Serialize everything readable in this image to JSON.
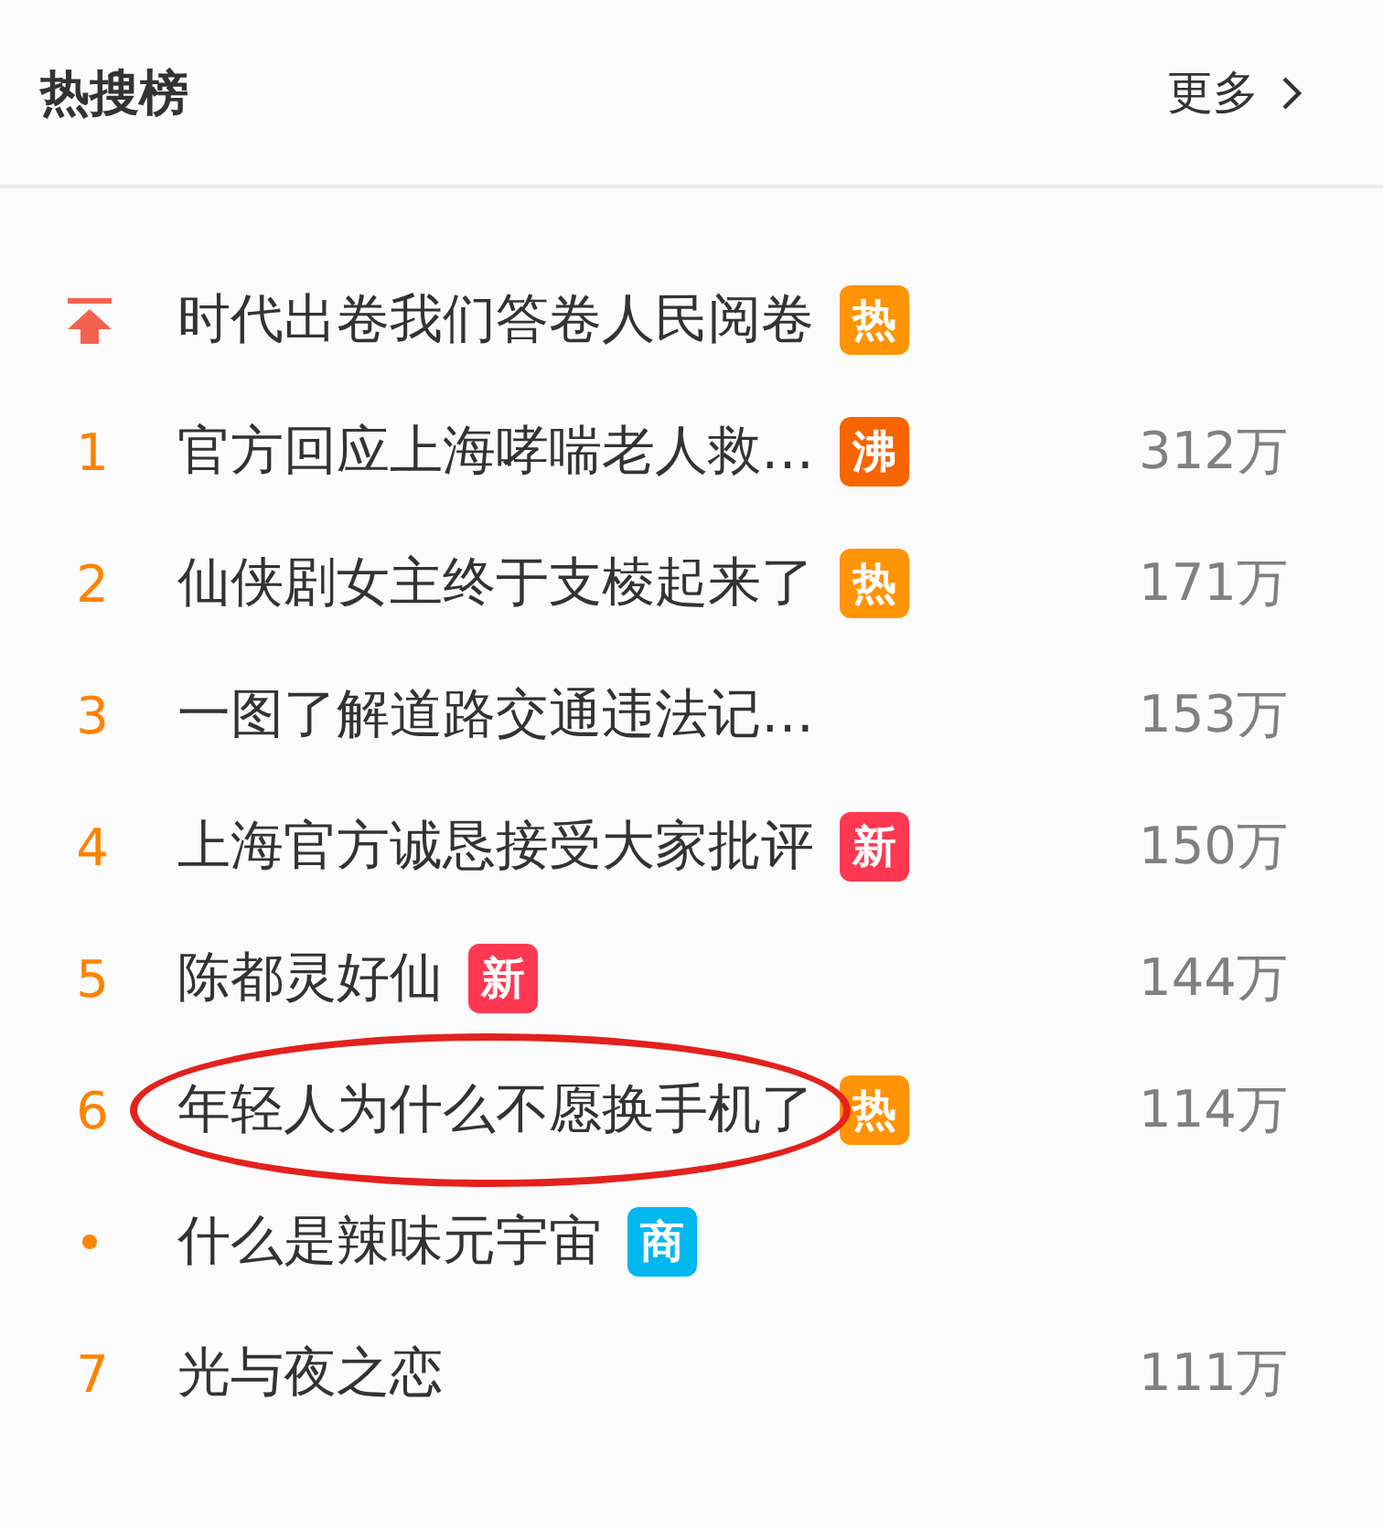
{
  "header": {
    "title": "热搜榜",
    "more_link": "更多"
  },
  "items": [
    {
      "rank": {
        "kind": "pinned"
      },
      "title": "时代出卷我们答卷人民阅卷",
      "badge": {
        "label": "热",
        "color": "#ff9406"
      },
      "circled": false
    },
    {
      "rank": {
        "kind": "number",
        "label": "1"
      },
      "title": "官方回应上海哮喘老人救…",
      "badge": {
        "label": "沸",
        "color": "#f86400"
      },
      "count": "312万",
      "circled": false
    },
    {
      "rank": {
        "kind": "number",
        "label": "2"
      },
      "title": "仙侠剧女主终于支棱起来了",
      "badge": {
        "label": "热",
        "color": "#ff9406"
      },
      "count": "171万",
      "circled": false
    },
    {
      "rank": {
        "kind": "number",
        "label": "3"
      },
      "title": "一图了解道路交通违法记…",
      "count": "153万",
      "circled": false
    },
    {
      "rank": {
        "kind": "number",
        "label": "4"
      },
      "title": "上海官方诚恳接受大家批评",
      "badge": {
        "label": "新",
        "color": "#ff3852"
      },
      "count": "150万",
      "circled": false
    },
    {
      "rank": {
        "kind": "number",
        "label": "5"
      },
      "title": "陈都灵好仙",
      "badge": {
        "label": "新",
        "color": "#ff3852"
      },
      "count": "144万",
      "circled": false
    },
    {
      "rank": {
        "kind": "number",
        "label": "6"
      },
      "title": "年轻人为什么不愿换手机了",
      "badge": {
        "label": "热",
        "color": "#ff9406"
      },
      "count": "114万",
      "circled": true
    },
    {
      "rank": {
        "kind": "dot"
      },
      "title": "什么是辣味元宇宙",
      "badge": {
        "label": "商",
        "color": "#00b7ee"
      },
      "circled": false
    },
    {
      "rank": {
        "kind": "number",
        "label": "7"
      },
      "title": "光与夜之恋",
      "count": "111万",
      "circled": false
    }
  ]
}
